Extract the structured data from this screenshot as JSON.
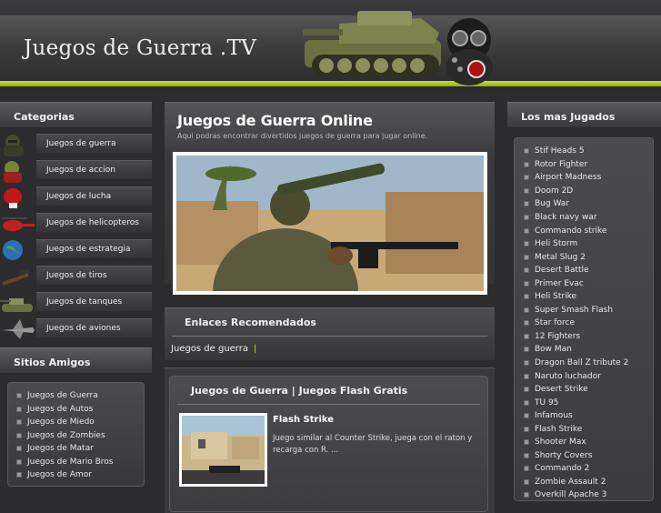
{
  "header": {
    "site_title": "Juegos de Guerra .TV"
  },
  "categories": {
    "title": "Categorias",
    "items": [
      {
        "label": "Juegos de guerra",
        "icon": "soldier-icon"
      },
      {
        "label": "Juegos de accion",
        "icon": "fighter-icon"
      },
      {
        "label": "Juegos de lucha",
        "icon": "boxing-glove-icon"
      },
      {
        "label": "Juegos de helicopteros",
        "icon": "helicopter-icon"
      },
      {
        "label": "Juegos de estrategia",
        "icon": "globe-icon"
      },
      {
        "label": "Juegos de tiros",
        "icon": "rifle-icon"
      },
      {
        "label": "Juegos de tanques",
        "icon": "tank-icon"
      },
      {
        "label": "Juegos de aviones",
        "icon": "jet-icon"
      }
    ]
  },
  "friends": {
    "title": "Sitios Amigos",
    "items": [
      "Juegos de Guerra",
      "Juegos de Autos",
      "Juegos de Miedo",
      "Juegos de Zombies",
      "Juegos de Matar",
      "Juegos de Mario Bros",
      "Juegos de Amor"
    ]
  },
  "main": {
    "title": "Juegos de Guerra Online",
    "subtitle": "Aqui podras encontrar divertidos juegos de guerra para jugar online."
  },
  "links": {
    "title": "Enlaces Recomendados",
    "items": [
      "Juegos de guerra"
    ],
    "separator": "|"
  },
  "games": {
    "title": "Juegos de Guerra | Juegos Flash Gratis",
    "items": [
      {
        "name": "Flash Strike",
        "description": "Juego similar al Counter Strike, juega con el raton y recarga con R. ..."
      }
    ]
  },
  "popular": {
    "title": "Los mas Jugados",
    "items": [
      "Stif Heads 5",
      "Rotor Fighter",
      "Airport Madness",
      "Doom 2D",
      "Bug War",
      "Black navy war",
      "Commando strike",
      "Heli Storm",
      "Metal Slug 2",
      "Desert Battle",
      "Primer Evac",
      "Heli Strike",
      "Super Smash Flash",
      "Star force",
      "12 Fighters",
      "Bow Man",
      "Dragon Ball Z tribute 2",
      "Naruto luchador",
      "Desert Strike",
      "TU 95",
      "Infamous",
      "Flash Strike",
      "Shooter Max",
      "Shorty Covers",
      "Commando 2",
      "Zombie Assault 2",
      "Overkill Apache 3"
    ]
  },
  "colors": {
    "accent": "#b8d12a",
    "background": "#2c2c2e"
  }
}
